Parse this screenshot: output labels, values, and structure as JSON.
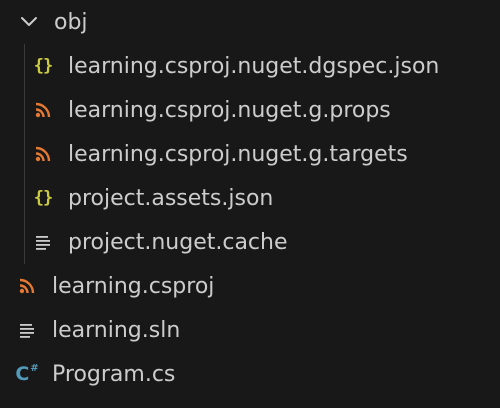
{
  "explorer": {
    "folder": {
      "label": "obj",
      "expanded": true,
      "icon": "chevron-down-icon"
    },
    "nested_files": [
      {
        "label": "learning.csproj.nuget.dgspec.json",
        "icon": "json-braces-icon",
        "icon_color": "#cbcb41"
      },
      {
        "label": "learning.csproj.nuget.g.props",
        "icon": "rss-feed-icon",
        "icon_color": "#e37933"
      },
      {
        "label": "learning.csproj.nuget.g.targets",
        "icon": "rss-feed-icon",
        "icon_color": "#e37933"
      },
      {
        "label": "project.assets.json",
        "icon": "json-braces-icon",
        "icon_color": "#cbcb41"
      },
      {
        "label": "project.nuget.cache",
        "icon": "text-lines-icon",
        "icon_color": "#cccccc"
      }
    ],
    "root_files": [
      {
        "label": "learning.csproj",
        "icon": "rss-feed-icon",
        "icon_color": "#e37933"
      },
      {
        "label": "learning.sln",
        "icon": "text-lines-icon",
        "icon_color": "#cccccc"
      },
      {
        "label": "Program.cs",
        "icon": "csharp-icon",
        "icon_color": "#519aba"
      }
    ],
    "background": "#181818",
    "text_color": "#cccccc"
  }
}
